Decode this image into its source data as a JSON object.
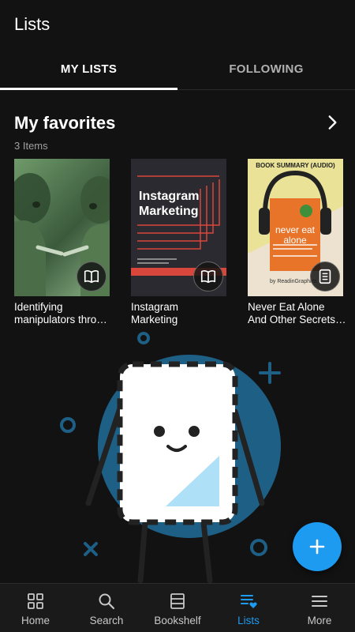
{
  "header": {
    "title": "Lists"
  },
  "tabs": [
    {
      "label": "MY LISTS",
      "active": true
    },
    {
      "label": "FOLLOWING",
      "active": false
    }
  ],
  "favorites": {
    "title": "My favorites",
    "count": "3 Items",
    "books": [
      {
        "title_line1": "Identifying",
        "title_line2": "manipulators thro…",
        "type_icon": "book-icon"
      },
      {
        "title_line1": "Instagram",
        "title_line2": "Marketing",
        "type_icon": "book-icon",
        "cover_text": [
          "Instagram",
          "Marketing"
        ]
      },
      {
        "title_line1": "Never Eat Alone",
        "title_line2": "And Other Secrets…",
        "type_icon": "audio-summary-icon",
        "cover_header": "BOOK SUMMARY (AUDIO)",
        "cover_title": [
          "never eat",
          "alone"
        ],
        "cover_footer": "by ReadinGraphics"
      }
    ]
  },
  "fab": {
    "icon": "plus-icon"
  },
  "bottom_nav": [
    {
      "label": "Home",
      "icon": "grid-icon",
      "active": false
    },
    {
      "label": "Search",
      "icon": "search-icon",
      "active": false
    },
    {
      "label": "Bookshelf",
      "icon": "bookshelf-icon",
      "active": false
    },
    {
      "label": "Lists",
      "icon": "lists-icon",
      "active": true
    },
    {
      "label": "More",
      "icon": "menu-icon",
      "active": false
    }
  ],
  "colors": {
    "accent": "#1d9bf0",
    "background": "#121212",
    "nav_background": "#1a1a1a",
    "illustration_circle": "#1e5f86"
  }
}
